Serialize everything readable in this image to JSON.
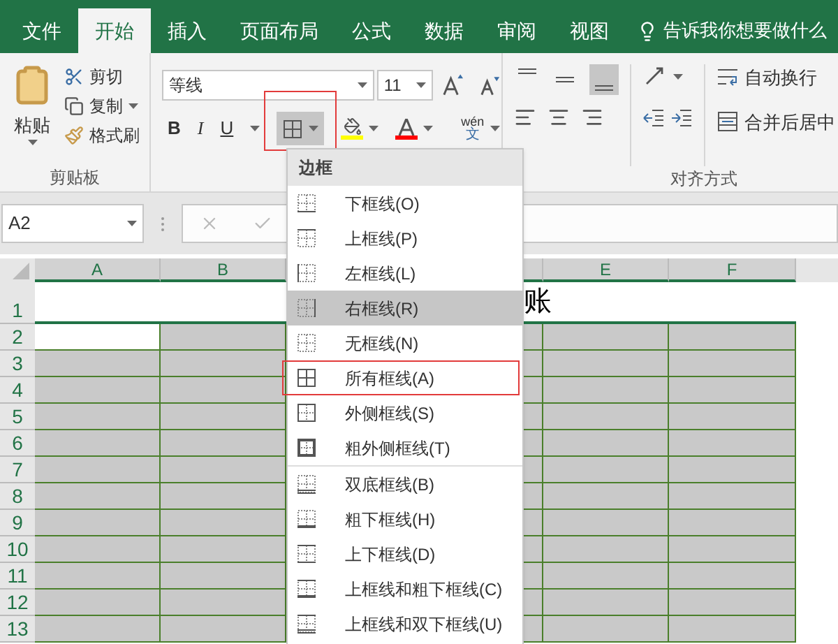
{
  "tabs": [
    {
      "label": "文件",
      "selected": false
    },
    {
      "label": "开始",
      "selected": true
    },
    {
      "label": "插入",
      "selected": false
    },
    {
      "label": "页面布局",
      "selected": false
    },
    {
      "label": "公式",
      "selected": false
    },
    {
      "label": "数据",
      "selected": false
    },
    {
      "label": "审阅",
      "selected": false
    },
    {
      "label": "视图",
      "selected": false
    }
  ],
  "tell_me": "告诉我你想要做什么",
  "clipboard": {
    "paste": "粘贴",
    "cut": "剪切",
    "copy": "复制",
    "format_painter": "格式刷",
    "group_label": "剪贴板"
  },
  "font": {
    "name": "等线",
    "size": "11",
    "bold": "B",
    "italic": "I",
    "underline": "U",
    "phonetic_top": "wén",
    "phonetic_bottom": "文",
    "border_button_highlighted": true
  },
  "alignment": {
    "wrap_text": "自动换行",
    "merge_center": "合并后居中",
    "group_label": "对齐方式"
  },
  "name_box": "A2",
  "columns": [
    "A",
    "B",
    "E",
    "F"
  ],
  "rows": [
    "1",
    "2",
    "3",
    "4",
    "5",
    "6",
    "7",
    "8",
    "9",
    "10",
    "11",
    "12",
    "13"
  ],
  "title_cell": "账",
  "border_menu": {
    "title": "边框",
    "groups": [
      [
        {
          "label": "下框线(O)",
          "kind": "bottom",
          "selected": false,
          "highlighted": false
        },
        {
          "label": "上框线(P)",
          "kind": "top",
          "selected": false,
          "highlighted": false
        },
        {
          "label": "左框线(L)",
          "kind": "left",
          "selected": false,
          "highlighted": false
        },
        {
          "label": "右框线(R)",
          "kind": "right",
          "selected": true,
          "highlighted": false
        },
        {
          "label": "无框线(N)",
          "kind": "none",
          "selected": false,
          "highlighted": false
        },
        {
          "label": "所有框线(A)",
          "kind": "all",
          "selected": false,
          "highlighted": true
        },
        {
          "label": "外侧框线(S)",
          "kind": "outside",
          "selected": false,
          "highlighted": false
        },
        {
          "label": "粗外侧框线(T)",
          "kind": "thick_outside",
          "selected": false,
          "highlighted": false
        }
      ],
      [
        {
          "label": "双底框线(B)",
          "kind": "double_bottom",
          "selected": false,
          "highlighted": false
        },
        {
          "label": "粗下框线(H)",
          "kind": "thick_bottom",
          "selected": false,
          "highlighted": false
        },
        {
          "label": "上下框线(D)",
          "kind": "top_bottom",
          "selected": false,
          "highlighted": false
        },
        {
          "label": "上框线和粗下框线(C)",
          "kind": "top_thick_bottom",
          "selected": false,
          "highlighted": false
        },
        {
          "label": "上框线和双下框线(U)",
          "kind": "top_double_bottom",
          "selected": false,
          "highlighted": false
        }
      ]
    ]
  }
}
